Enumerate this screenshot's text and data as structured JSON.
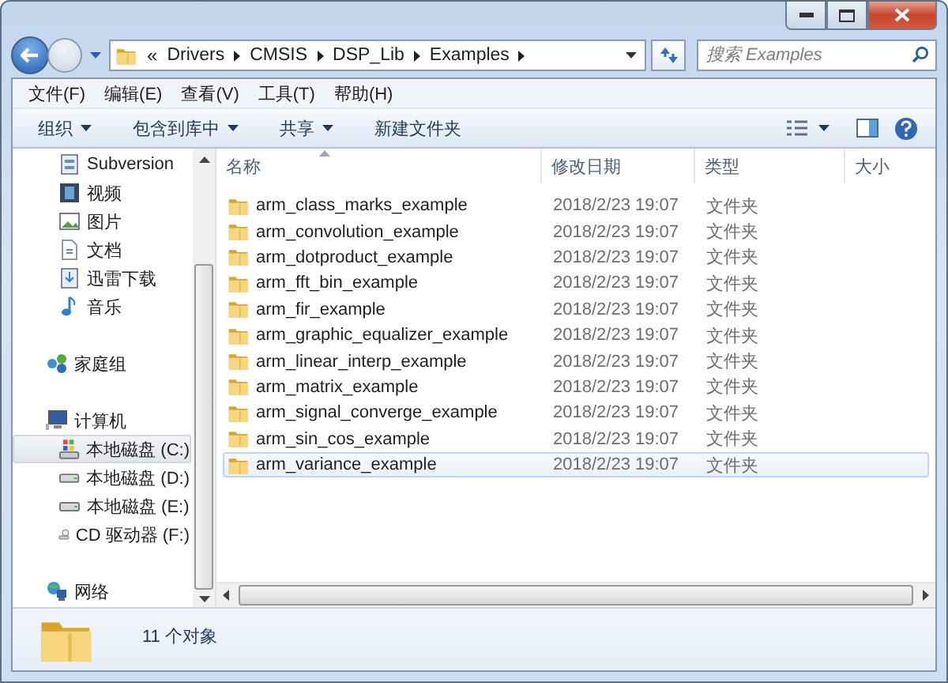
{
  "address_bar": {
    "overflow": "«",
    "crumbs": [
      "Drivers",
      "CMSIS",
      "DSP_Lib",
      "Examples"
    ]
  },
  "search": {
    "placeholder": "搜索 Examples"
  },
  "menu": [
    "文件(F)",
    "编辑(E)",
    "查看(V)",
    "工具(T)",
    "帮助(H)"
  ],
  "toolbar": [
    {
      "label": "组织",
      "dropdown": true
    },
    {
      "label": "包含到库中",
      "dropdown": true
    },
    {
      "label": "共享",
      "dropdown": true
    },
    {
      "label": "新建文件夹",
      "dropdown": false
    }
  ],
  "sidebar": {
    "sections": [
      {
        "items": [
          {
            "label": "Subversion",
            "kind": "svn",
            "selected": false
          },
          {
            "label": "视频",
            "kind": "video",
            "selected": false
          },
          {
            "label": "图片",
            "kind": "picture",
            "selected": false
          },
          {
            "label": "文档",
            "kind": "document",
            "selected": false
          },
          {
            "label": "迅雷下载",
            "kind": "download",
            "selected": false
          },
          {
            "label": "音乐",
            "kind": "music",
            "selected": false
          }
        ]
      },
      {
        "header": {
          "label": "家庭组",
          "kind": "homegroup",
          "selected": false
        }
      },
      {
        "header": {
          "label": "计算机",
          "kind": "computer",
          "selected": false
        },
        "items": [
          {
            "label": "本地磁盘 (C:)",
            "kind": "system-drive",
            "selected": true
          },
          {
            "label": "本地磁盘 (D:)",
            "kind": "drive",
            "selected": false
          },
          {
            "label": "本地磁盘 (E:)",
            "kind": "drive",
            "selected": false
          },
          {
            "label": "CD 驱动器 (F:)",
            "kind": "cd",
            "selected": false
          }
        ]
      },
      {
        "header": {
          "label": "网络",
          "kind": "network",
          "selected": false
        }
      }
    ]
  },
  "table": {
    "columns": [
      {
        "label": "名称",
        "sorted": true
      },
      {
        "label": "修改日期",
        "sorted": false
      },
      {
        "label": "类型",
        "sorted": false
      },
      {
        "label": "大小",
        "sorted": false
      }
    ],
    "rows": [
      {
        "name": "arm_class_marks_example",
        "date": "2018/2/23 19:07",
        "type": "文件夹",
        "selected": false
      },
      {
        "name": "arm_convolution_example",
        "date": "2018/2/23 19:07",
        "type": "文件夹",
        "selected": false
      },
      {
        "name": "arm_dotproduct_example",
        "date": "2018/2/23 19:07",
        "type": "文件夹",
        "selected": false
      },
      {
        "name": "arm_fft_bin_example",
        "date": "2018/2/23 19:07",
        "type": "文件夹",
        "selected": false
      },
      {
        "name": "arm_fir_example",
        "date": "2018/2/23 19:07",
        "type": "文件夹",
        "selected": false
      },
      {
        "name": "arm_graphic_equalizer_example",
        "date": "2018/2/23 19:07",
        "type": "文件夹",
        "selected": false
      },
      {
        "name": "arm_linear_interp_example",
        "date": "2018/2/23 19:07",
        "type": "文件夹",
        "selected": false
      },
      {
        "name": "arm_matrix_example",
        "date": "2018/2/23 19:07",
        "type": "文件夹",
        "selected": false
      },
      {
        "name": "arm_signal_converge_example",
        "date": "2018/2/23 19:07",
        "type": "文件夹",
        "selected": false
      },
      {
        "name": "arm_sin_cos_example",
        "date": "2018/2/23 19:07",
        "type": "文件夹",
        "selected": false
      },
      {
        "name": "arm_variance_example",
        "date": "2018/2/23 19:07",
        "type": "文件夹",
        "selected": true
      }
    ]
  },
  "status_bar": {
    "text": "11 个对象"
  }
}
